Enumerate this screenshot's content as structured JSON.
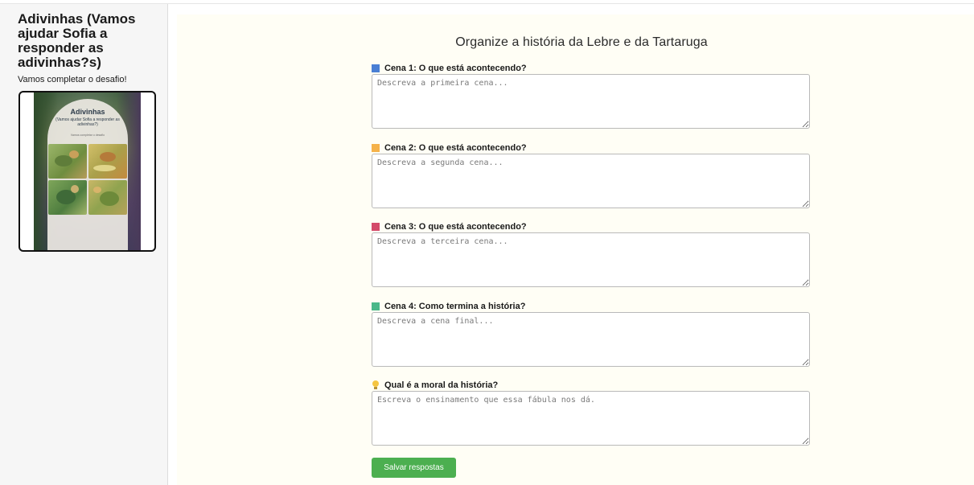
{
  "sidebar": {
    "title": "Adivinhas (Vamos ajudar Sofia a responder as adivinhas?s)",
    "subtitle": "Vamos completar o desafio!",
    "cover": {
      "title": "Adivinhas",
      "subtitle": "(Vamos ajudar Sofia a responder as adivinhas?)",
      "small_text": "Vamos completar o desafio"
    }
  },
  "main": {
    "title": "Organize a história da Lebre e da Tartaruga",
    "scenes": [
      {
        "label": "Cena 1: O que está acontecendo?",
        "placeholder": "Descreva a primeira cena...",
        "color": "#4a7fd4",
        "value": ""
      },
      {
        "label": "Cena 2: O que está acontecendo?",
        "placeholder": "Descreva a segunda cena...",
        "color": "#f5b24a",
        "value": ""
      },
      {
        "label": "Cena 3: O que está acontecendo?",
        "placeholder": "Descreva a terceira cena...",
        "color": "#d44a6a",
        "value": ""
      },
      {
        "label": "Cena 4: Como termina a história?",
        "placeholder": "Descreva a cena final...",
        "color": "#4ab88a",
        "value": ""
      }
    ],
    "moral": {
      "label": "Qual é a moral da história?",
      "placeholder": "Escreva o ensinamento que essa fábula nos dá.",
      "icon": "lightbulb-icon",
      "value": ""
    },
    "save_label": "Salvar respostas",
    "save_color": "#4caf50"
  }
}
